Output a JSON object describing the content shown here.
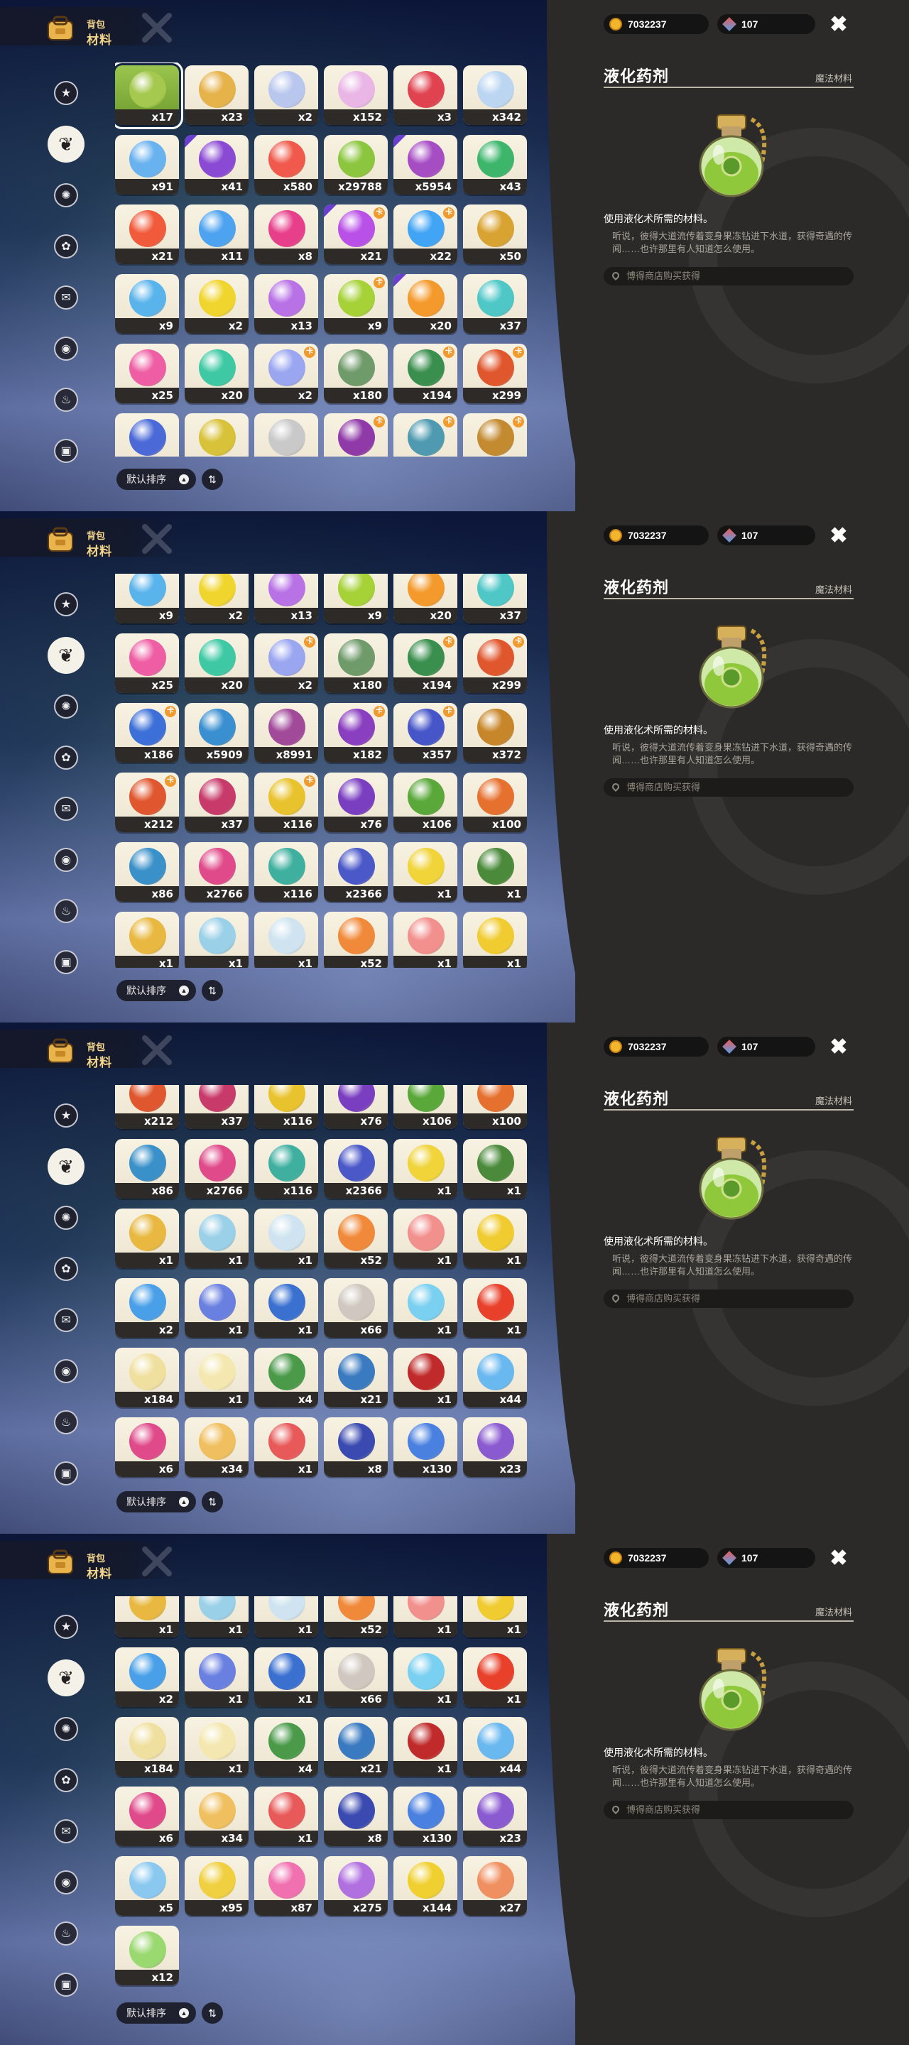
{
  "header": {
    "sub": "背包",
    "title": "材料"
  },
  "sort": {
    "label": "默认排序",
    "arrow": "▲",
    "toggle": "⇅"
  },
  "currency": {
    "gold": "7032237",
    "gems": "107"
  },
  "detail": {
    "name": "液化药剂",
    "category": "魔法材料",
    "desc": "使用液化术所需的材料。",
    "lore": "听说，彼得大道流传着变身果冻钻进下水道，获得奇遇的传闻……也许那里有人知道怎么使用。",
    "source": "博得商店购买获得"
  },
  "categories": [
    {
      "icon": "star-icon",
      "glyph": "★"
    },
    {
      "icon": "leaf-icon",
      "glyph": "❦"
    },
    {
      "icon": "gear-icon",
      "glyph": "✺"
    },
    {
      "icon": "pet-icon",
      "glyph": "✿"
    },
    {
      "icon": "book-icon",
      "glyph": "✉"
    },
    {
      "icon": "ball-icon",
      "glyph": "◉"
    },
    {
      "icon": "bell-icon",
      "glyph": "♨"
    },
    {
      "icon": "chest-icon",
      "glyph": "▣"
    }
  ],
  "colors": {
    "panel": "#2b2a29",
    "badge": "#f29a2e",
    "purple_corner": "#6a3fd0"
  },
  "views": [
    {
      "rows": [
        [
          {
            "c": "x17",
            "col": "#a5c84f",
            "sel": true
          },
          {
            "c": "x23",
            "col": "#e6b24a"
          },
          {
            "c": "x2",
            "col": "#b9c7ef"
          },
          {
            "c": "x152",
            "col": "#e9b6e6"
          },
          {
            "c": "x3",
            "col": "#e0424f"
          },
          {
            "c": "x342",
            "col": "#bcd6f2"
          }
        ],
        [
          {
            "c": "x91",
            "col": "#69b2f0"
          },
          {
            "c": "x41",
            "col": "#8b4ad4",
            "corner": true
          },
          {
            "c": "x580",
            "col": "#f0594b"
          },
          {
            "c": "x29788",
            "col": "#8cc63f"
          },
          {
            "c": "x5954",
            "col": "#a64dc4",
            "corner": true
          },
          {
            "c": "x43",
            "col": "#3db66c"
          }
        ],
        [
          {
            "c": "x21",
            "col": "#f15a3a"
          },
          {
            "c": "x11",
            "col": "#4ea3f0"
          },
          {
            "c": "x8",
            "col": "#e83f8b"
          },
          {
            "c": "x21",
            "col": "#b950e8",
            "badge": true,
            "corner": true
          },
          {
            "c": "x22",
            "col": "#42a4f4",
            "badge": true
          },
          {
            "c": "x50",
            "col": "#d9a331"
          }
        ],
        [
          {
            "c": "x9",
            "col": "#5ab4ec"
          },
          {
            "c": "x2",
            "col": "#f0d52e"
          },
          {
            "c": "x13",
            "col": "#b872e6"
          },
          {
            "c": "x9",
            "col": "#a6d237",
            "badge": true
          },
          {
            "c": "x20",
            "col": "#f49a2c",
            "corner": true
          },
          {
            "c": "x37",
            "col": "#4fc7c7"
          }
        ],
        [
          {
            "c": "x25",
            "col": "#ef5ea4"
          },
          {
            "c": "x20",
            "col": "#3ec9a4"
          },
          {
            "c": "x2",
            "col": "#9aa6f0",
            "badge": true
          },
          {
            "c": "x180",
            "col": "#6f9a6a"
          },
          {
            "c": "x194",
            "col": "#3a8f4f",
            "badge": true
          },
          {
            "c": "x299",
            "col": "#e0572e",
            "badge": true
          }
        ],
        [
          {
            "c": "",
            "col": "#4b6ad8"
          },
          {
            "c": "",
            "col": "#d8c23a"
          },
          {
            "c": "",
            "col": "#c9c9c9"
          },
          {
            "c": "",
            "col": "#8f3aa8",
            "badge": true
          },
          {
            "c": "",
            "col": "#4f9ab0",
            "badge": true
          },
          {
            "c": "",
            "col": "#c38a30",
            "badge": true
          }
        ]
      ]
    },
    {
      "rows": [
        [
          {
            "c": "x9",
            "col": "#5ab4ec"
          },
          {
            "c": "x2",
            "col": "#f0d52e"
          },
          {
            "c": "x13",
            "col": "#b872e6"
          },
          {
            "c": "x9",
            "col": "#a6d237"
          },
          {
            "c": "x20",
            "col": "#f49a2c"
          },
          {
            "c": "x37",
            "col": "#4fc7c7"
          }
        ],
        [
          {
            "c": "x25",
            "col": "#ef5ea4"
          },
          {
            "c": "x20",
            "col": "#3ec9a4"
          },
          {
            "c": "x2",
            "col": "#9aa6f0",
            "badge": true
          },
          {
            "c": "x180",
            "col": "#6f9a6a"
          },
          {
            "c": "x194",
            "col": "#3a8f4f",
            "badge": true
          },
          {
            "c": "x299",
            "col": "#e0572e",
            "badge": true
          }
        ],
        [
          {
            "c": "x186",
            "col": "#3d6fd8",
            "badge": true
          },
          {
            "c": "x5909",
            "col": "#3a8fd0"
          },
          {
            "c": "x8991",
            "col": "#a24a9a"
          },
          {
            "c": "x182",
            "col": "#8a3fc0",
            "badge": true
          },
          {
            "c": "x357",
            "col": "#4656c8",
            "badge": true
          },
          {
            "c": "x372",
            "col": "#c8862a"
          }
        ],
        [
          {
            "c": "x212",
            "col": "#e0562e",
            "badge": true
          },
          {
            "c": "x37",
            "col": "#c73a6a"
          },
          {
            "c": "x116",
            "col": "#e9c32e",
            "badge": true
          },
          {
            "c": "x76",
            "col": "#7a3fc0"
          },
          {
            "c": "x106",
            "col": "#5aa83a"
          },
          {
            "c": "x100",
            "col": "#e6702e"
          }
        ],
        [
          {
            "c": "x86",
            "col": "#3a90c8"
          },
          {
            "c": "x2766",
            "col": "#e04a8a"
          },
          {
            "c": "x116",
            "col": "#3fb0a0"
          },
          {
            "c": "x2366",
            "col": "#4a58c8"
          },
          {
            "c": "x1",
            "col": "#f0d43a"
          },
          {
            "c": "x1",
            "col": "#4a8a3a"
          }
        ],
        [
          {
            "c": "x1",
            "col": "#e8b840"
          },
          {
            "c": "x1",
            "col": "#9ad0e8"
          },
          {
            "c": "x1",
            "col": "#cfe4f0"
          },
          {
            "c": "x52",
            "col": "#f08a3a"
          },
          {
            "c": "x1",
            "col": "#f2908e"
          },
          {
            "c": "x1",
            "col": "#f0cc30"
          }
        ]
      ]
    },
    {
      "rows": [
        [
          {
            "c": "x212",
            "col": "#e0562e"
          },
          {
            "c": "x37",
            "col": "#c73a6a"
          },
          {
            "c": "x116",
            "col": "#e9c32e"
          },
          {
            "c": "x76",
            "col": "#7a3fc0"
          },
          {
            "c": "x106",
            "col": "#5aa83a"
          },
          {
            "c": "x100",
            "col": "#e6702e"
          }
        ],
        [
          {
            "c": "x86",
            "col": "#3a90c8"
          },
          {
            "c": "x2766",
            "col": "#e04a8a"
          },
          {
            "c": "x116",
            "col": "#3fb0a0"
          },
          {
            "c": "x2366",
            "col": "#4a58c8"
          },
          {
            "c": "x1",
            "col": "#f0d43a"
          },
          {
            "c": "x1",
            "col": "#4a8a3a"
          }
        ],
        [
          {
            "c": "x1",
            "col": "#e8b840"
          },
          {
            "c": "x1",
            "col": "#9ad0e8"
          },
          {
            "c": "x1",
            "col": "#cfe4f0"
          },
          {
            "c": "x52",
            "col": "#f08a3a"
          },
          {
            "c": "x1",
            "col": "#f2908e"
          },
          {
            "c": "x1",
            "col": "#f0cc30"
          }
        ],
        [
          {
            "c": "x2",
            "col": "#4aa0e8"
          },
          {
            "c": "x1",
            "col": "#6a80e0"
          },
          {
            "c": "x1",
            "col": "#3a70d0"
          },
          {
            "c": "x66",
            "col": "#d0c8c0"
          },
          {
            "c": "x1",
            "col": "#7ad0f0"
          },
          {
            "c": "x1",
            "col": "#e8402a"
          }
        ],
        [
          {
            "c": "x184",
            "col": "#f0e0a0"
          },
          {
            "c": "x1",
            "col": "#f4e8b0"
          },
          {
            "c": "x4",
            "col": "#4a9a4a"
          },
          {
            "c": "x21",
            "col": "#3a7ac0"
          },
          {
            "c": "x1",
            "col": "#c02a2a"
          },
          {
            "c": "x44",
            "col": "#6ab8f0"
          }
        ],
        [
          {
            "c": "x6",
            "col": "#e04a8a"
          },
          {
            "c": "x34",
            "col": "#f0c060"
          },
          {
            "c": "x1",
            "col": "#e85a5a"
          },
          {
            "c": "x8",
            "col": "#3a4ab0"
          },
          {
            "c": "x130",
            "col": "#4a80e0"
          },
          {
            "c": "x23",
            "col": "#8a5ad0"
          }
        ]
      ]
    },
    {
      "rows": [
        [
          {
            "c": "x1",
            "col": "#e8b840"
          },
          {
            "c": "x1",
            "col": "#9ad0e8"
          },
          {
            "c": "x1",
            "col": "#cfe4f0"
          },
          {
            "c": "x52",
            "col": "#f08a3a"
          },
          {
            "c": "x1",
            "col": "#f2908e"
          },
          {
            "c": "x1",
            "col": "#f0cc30"
          }
        ],
        [
          {
            "c": "x2",
            "col": "#4aa0e8"
          },
          {
            "c": "x1",
            "col": "#6a80e0"
          },
          {
            "c": "x1",
            "col": "#3a70d0"
          },
          {
            "c": "x66",
            "col": "#d0c8c0"
          },
          {
            "c": "x1",
            "col": "#7ad0f0"
          },
          {
            "c": "x1",
            "col": "#e8402a"
          }
        ],
        [
          {
            "c": "x184",
            "col": "#f0e0a0"
          },
          {
            "c": "x1",
            "col": "#f4e8b0"
          },
          {
            "c": "x4",
            "col": "#4a9a4a"
          },
          {
            "c": "x21",
            "col": "#3a7ac0"
          },
          {
            "c": "x1",
            "col": "#c02a2a"
          },
          {
            "c": "x44",
            "col": "#6ab8f0"
          }
        ],
        [
          {
            "c": "x6",
            "col": "#e04a8a"
          },
          {
            "c": "x34",
            "col": "#f0c060"
          },
          {
            "c": "x1",
            "col": "#e85a5a"
          },
          {
            "c": "x8",
            "col": "#3a4ab0"
          },
          {
            "c": "x130",
            "col": "#4a80e0"
          },
          {
            "c": "x23",
            "col": "#8a5ad0"
          }
        ],
        [
          {
            "c": "x5",
            "col": "#8ac8f0"
          },
          {
            "c": "x95",
            "col": "#f0d040"
          },
          {
            "c": "x87",
            "col": "#f070b0"
          },
          {
            "c": "x275",
            "col": "#b070e0"
          },
          {
            "c": "x144",
            "col": "#f0d030"
          },
          {
            "c": "x27",
            "col": "#f09060"
          }
        ],
        [
          {
            "c": "x12",
            "col": "#9ad870"
          }
        ]
      ]
    }
  ]
}
